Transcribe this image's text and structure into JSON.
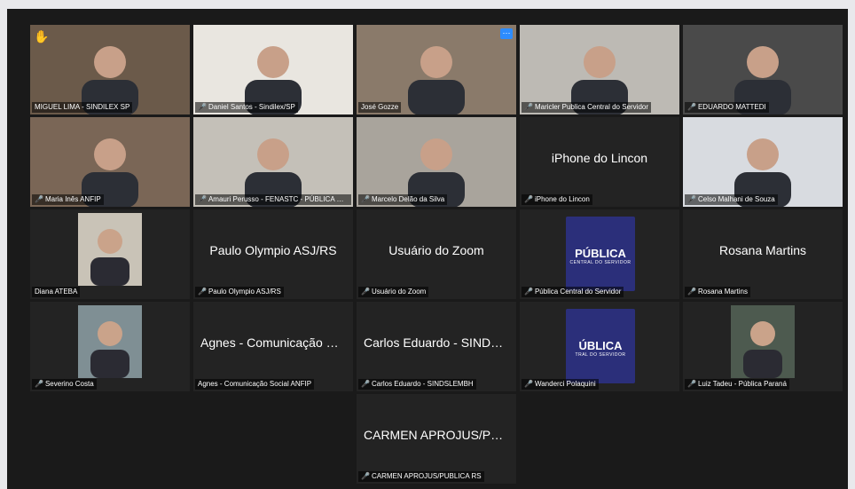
{
  "participants": [
    {
      "name": "MIGUEL LIMA - SINDILEX SP",
      "muted": false,
      "active": true,
      "hand": true,
      "bg": "#6b5a4a",
      "video": true
    },
    {
      "name": "Daniel Santos - Sindilex/SP",
      "muted": true,
      "video": true,
      "bg": "#e9e6e0"
    },
    {
      "name": "José Gozze",
      "muted": false,
      "video": true,
      "bg": "#8a7a6a",
      "dots": "⋯"
    },
    {
      "name": "Maricler Publica Central do Servidor",
      "muted": true,
      "video": true,
      "bg": "#bdbab4"
    },
    {
      "name": "EDUARDO MATTEDI",
      "muted": true,
      "video": true,
      "bg": "#4a4a4a"
    },
    {
      "name": "Maria Inês ANFIP",
      "muted": true,
      "video": true,
      "bg": "#7a6656"
    },
    {
      "name": "Amauri Perusso - FENASTC - PÚBLICA Ce...",
      "muted": true,
      "video": true,
      "bg": "#c4c0b8"
    },
    {
      "name": "Marcelo Delão da Silva",
      "muted": true,
      "video": true,
      "bg": "#a9a49c"
    },
    {
      "name": "iPhone do Lincon",
      "muted": true,
      "video": false,
      "bigname": "iPhone do Lincon"
    },
    {
      "name": "Celso Malhani de Souza",
      "muted": true,
      "video": true,
      "bg": "#d8dbe0"
    },
    {
      "name": "Diana ATEBA",
      "muted": false,
      "video": true,
      "thumb": true,
      "bg": "#c9c3b7"
    },
    {
      "name": "Paulo Olympio ASJ/RS",
      "muted": true,
      "video": false,
      "bigname": "Paulo Olympio ASJ/RS"
    },
    {
      "name": "Usuário do Zoom",
      "muted": true,
      "video": false,
      "bigname": "Usuário do Zoom"
    },
    {
      "name": "Pública Central do Servidor",
      "muted": true,
      "video": false,
      "logo": "PÚBLICA",
      "logo_sub": "CENTRAL DO SERVIDOR"
    },
    {
      "name": "Rosana Martins",
      "muted": true,
      "video": false,
      "bigname": "Rosana Martins"
    },
    {
      "name": "Severino Costa",
      "muted": true,
      "video": true,
      "thumb": true,
      "bg": "#7f8f94"
    },
    {
      "name": "Agnes - Comunicação Social ANFIP",
      "muted": false,
      "video": false,
      "bigname": "Agnes - Comunicação So..."
    },
    {
      "name": "Carlos Eduardo - SINDSLEMBH",
      "muted": true,
      "video": false,
      "bigname": "Carlos Eduardo - SINDSL..."
    },
    {
      "name": "Wanderci Polaquini",
      "muted": true,
      "video": false,
      "logo": "ÚBLICA",
      "logo_sub": "TRAL DO SERVIDOR"
    },
    {
      "name": "Luiz Tadeu - Pública Paraná",
      "muted": true,
      "video": true,
      "thumb": true,
      "bg": "#4d5a4f"
    },
    {
      "name": "CARMEN APROJUS/PUBLICA RS",
      "muted": true,
      "video": false,
      "bigname": "CARMEN APROJUS/PUBL..."
    }
  ],
  "icons": {
    "mic": "muted-mic-icon",
    "hand": "raised-hand-icon"
  },
  "hand_glyph": "✋",
  "mic_glyph": "🎤"
}
